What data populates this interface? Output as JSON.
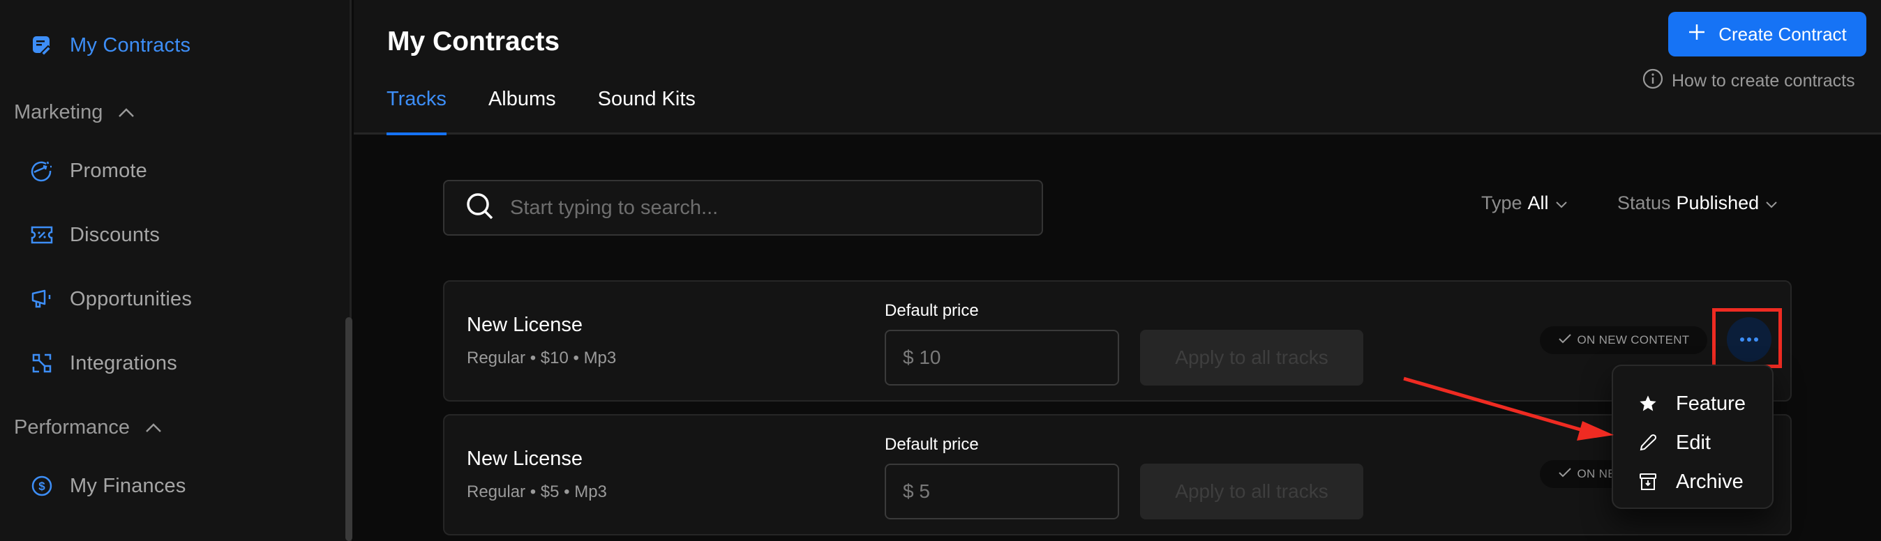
{
  "sidebar": {
    "active_item": {
      "label": "My Contracts",
      "icon": "contract-edit-icon"
    },
    "sections": [
      {
        "label": "Marketing",
        "expanded": true,
        "items": [
          {
            "label": "Promote",
            "icon": "promote-icon"
          },
          {
            "label": "Discounts",
            "icon": "discount-ticket-icon"
          },
          {
            "label": "Opportunities",
            "icon": "megaphone-icon"
          },
          {
            "label": "Integrations",
            "icon": "integrations-icon"
          }
        ]
      },
      {
        "label": "Performance",
        "expanded": true,
        "items": [
          {
            "label": "My Finances",
            "icon": "dollar-circle-icon"
          }
        ]
      }
    ]
  },
  "header": {
    "title": "My Contracts",
    "tabs": [
      {
        "label": "Tracks",
        "active": true
      },
      {
        "label": "Albums",
        "active": false
      },
      {
        "label": "Sound Kits",
        "active": false
      }
    ],
    "create_button": "Create Contract",
    "help_link": "How to create contracts"
  },
  "search": {
    "placeholder": "Start typing to search...",
    "value": ""
  },
  "filters": {
    "type": {
      "label": "Type",
      "value": "All"
    },
    "status": {
      "label": "Status",
      "value": "Published"
    }
  },
  "contracts": [
    {
      "title": "New License",
      "subtitle": "Regular • $10 • Mp3",
      "price_label": "Default price",
      "price_value": "$ 10",
      "apply_label": "Apply to all tracks",
      "badge": "ON NEW CONTENT"
    },
    {
      "title": "New License",
      "subtitle": "Regular • $5 • Mp3",
      "price_label": "Default price",
      "price_value": "$ 5",
      "apply_label": "Apply to all tracks",
      "badge": "ON NEW CONTENT"
    }
  ],
  "context_menu": {
    "items": [
      {
        "label": "Feature",
        "icon": "star-icon"
      },
      {
        "label": "Edit",
        "icon": "pencil-icon"
      },
      {
        "label": "Archive",
        "icon": "archive-icon"
      }
    ]
  },
  "colors": {
    "accent": "#1673f5",
    "accent_text": "#3d8ef7",
    "annotation": "#ef2b22",
    "background": "#0b0b0b",
    "surface": "#141414"
  }
}
